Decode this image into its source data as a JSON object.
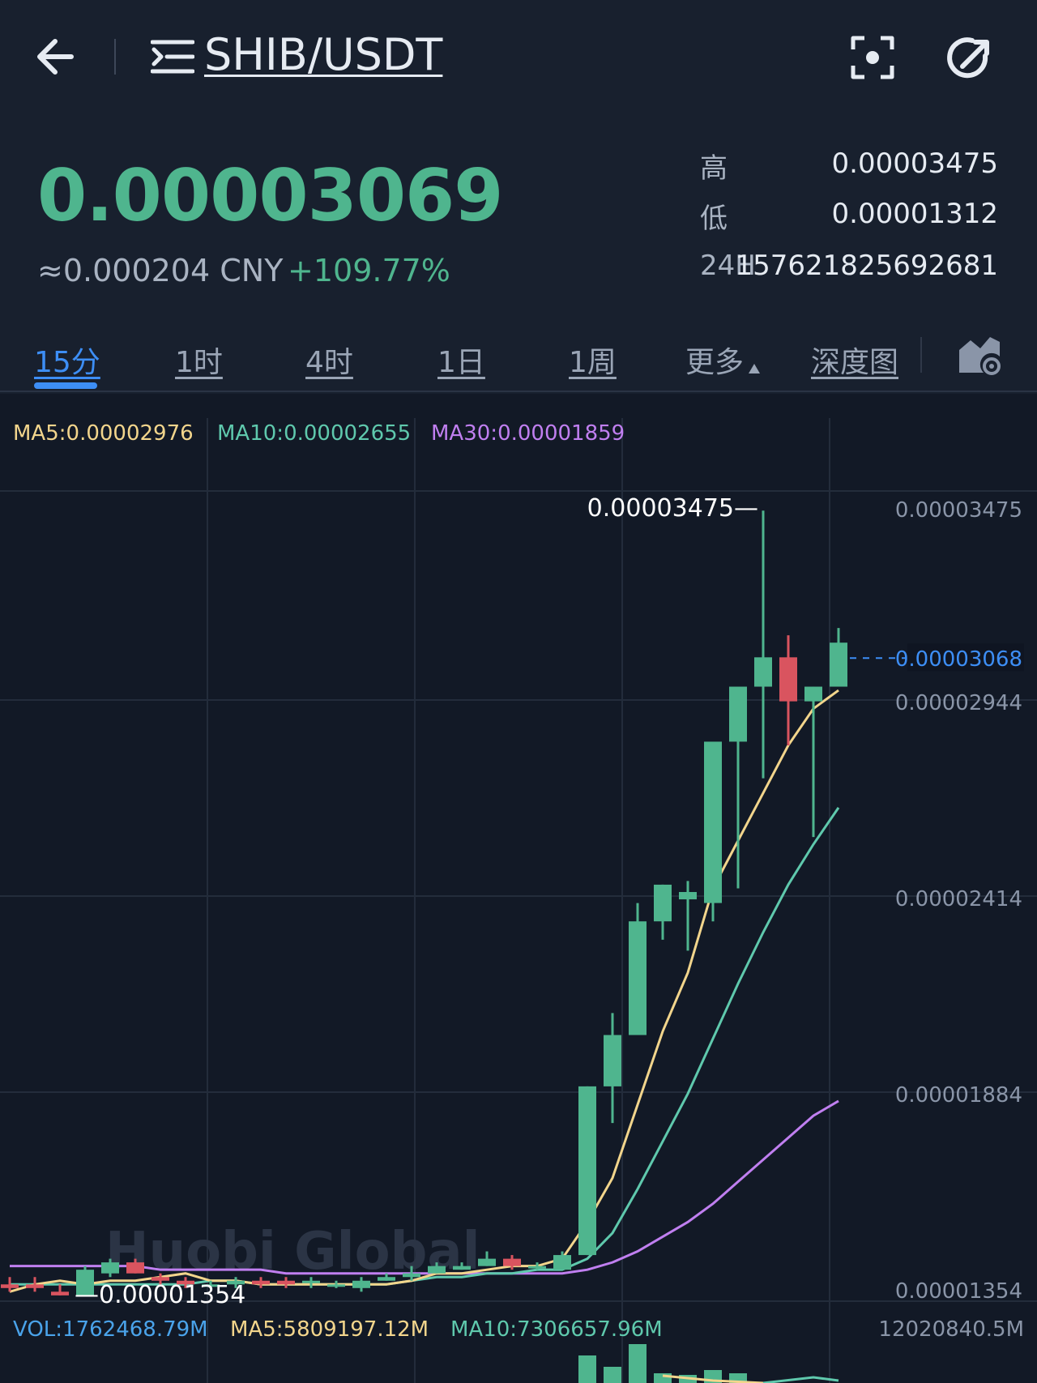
{
  "header": {
    "pair": "SHIB/USDT"
  },
  "ticker": {
    "last_price": "0.00003069",
    "cny_value": "≈0.000204 CNY",
    "change_pct": "+109.77%",
    "high_label": "高",
    "high_value": "0.00003475",
    "low_label": "低",
    "low_value": "0.00001312",
    "vol_label": "24H",
    "vol_value": "157621825692681"
  },
  "tabs": [
    {
      "label": "15分",
      "active": true
    },
    {
      "label": "1时"
    },
    {
      "label": "4时"
    },
    {
      "label": "1日"
    },
    {
      "label": "1周"
    },
    {
      "label": "更多"
    },
    {
      "label": "深度图"
    }
  ],
  "colors": {
    "up": "#4fb58e",
    "down": "#d9545f",
    "ma5": "#f2d58c",
    "ma10": "#5fc9ad",
    "ma30": "#c07ff0",
    "vol": "#4aa3ea",
    "accent": "#3d8ef5"
  },
  "chart_data": {
    "type": "candlestick",
    "indicators": {
      "ma5": "MA5:0.00002976",
      "ma10": "MA10:0.00002655",
      "ma30": "MA30:0.00001859"
    },
    "y_ticks": [
      "0.00003475",
      "0.00002944",
      "0.00002414",
      "0.00001884",
      "0.00001354"
    ],
    "ylim": [
      1.354e-05,
      3.475e-05
    ],
    "current_price_label": "0.00003068",
    "current_price": 3.068e-05,
    "max_marker": "0.00003475—",
    "min_marker": "—0.00001354",
    "candles": [
      {
        "o": 1.36e-05,
        "h": 1.38e-05,
        "l": 1.34e-05,
        "c": 1.35e-05
      },
      {
        "o": 1.36e-05,
        "h": 1.38e-05,
        "l": 1.34e-05,
        "c": 1.35e-05
      },
      {
        "o": 1.34e-05,
        "h": 1.36e-05,
        "l": 1.33e-05,
        "c": 1.33e-05
      },
      {
        "o": 1.33e-05,
        "h": 1.41e-05,
        "l": 1.33e-05,
        "c": 1.4e-05
      },
      {
        "o": 1.39e-05,
        "h": 1.43e-05,
        "l": 1.38e-05,
        "c": 1.42e-05
      },
      {
        "o": 1.42e-05,
        "h": 1.43e-05,
        "l": 1.39e-05,
        "c": 1.39e-05
      },
      {
        "o": 1.38e-05,
        "h": 1.39e-05,
        "l": 1.36e-05,
        "c": 1.37e-05
      },
      {
        "o": 1.37e-05,
        "h": 1.38e-05,
        "l": 1.35e-05,
        "c": 1.36e-05
      },
      {
        "o": 1.36e-05,
        "h": 1.37e-05,
        "l": 1.35e-05,
        "c": 1.36e-05
      },
      {
        "o": 1.36e-05,
        "h": 1.38e-05,
        "l": 1.35e-05,
        "c": 1.37e-05
      },
      {
        "o": 1.37e-05,
        "h": 1.38e-05,
        "l": 1.35e-05,
        "c": 1.36e-05
      },
      {
        "o": 1.37e-05,
        "h": 1.38e-05,
        "l": 1.35e-05,
        "c": 1.36e-05
      },
      {
        "o": 1.37e-05,
        "h": 1.38e-05,
        "l": 1.35e-05,
        "c": 1.37e-05
      },
      {
        "o": 1.36e-05,
        "h": 1.37e-05,
        "l": 1.35e-05,
        "c": 1.36e-05
      },
      {
        "o": 1.35e-05,
        "h": 1.38e-05,
        "l": 1.34e-05,
        "c": 1.37e-05
      },
      {
        "o": 1.37e-05,
        "h": 1.39e-05,
        "l": 1.37e-05,
        "c": 1.38e-05
      },
      {
        "o": 1.38e-05,
        "h": 1.41e-05,
        "l": 1.37e-05,
        "c": 1.39e-05
      },
      {
        "o": 1.39e-05,
        "h": 1.42e-05,
        "l": 1.39e-05,
        "c": 1.41e-05
      },
      {
        "o": 1.4e-05,
        "h": 1.42e-05,
        "l": 1.4e-05,
        "c": 1.41e-05
      },
      {
        "o": 1.41e-05,
        "h": 1.45e-05,
        "l": 1.41e-05,
        "c": 1.43e-05
      },
      {
        "o": 1.43e-05,
        "h": 1.44e-05,
        "l": 1.4e-05,
        "c": 1.41e-05
      },
      {
        "o": 1.41e-05,
        "h": 1.42e-05,
        "l": 1.4e-05,
        "c": 1.41e-05
      },
      {
        "o": 1.4e-05,
        "h": 1.45e-05,
        "l": 1.4e-05,
        "c": 1.44e-05
      },
      {
        "o": 1.44e-05,
        "h": 1.9e-05,
        "l": 1.44e-05,
        "c": 1.9e-05
      },
      {
        "o": 1.9e-05,
        "h": 2.1e-05,
        "l": 1.8e-05,
        "c": 2.04e-05
      },
      {
        "o": 2.04e-05,
        "h": 2.4e-05,
        "l": 2.04e-05,
        "c": 2.35e-05
      },
      {
        "o": 2.35e-05,
        "h": 2.45e-05,
        "l": 2.3e-05,
        "c": 2.45e-05
      },
      {
        "o": 2.41e-05,
        "h": 2.46e-05,
        "l": 2.27e-05,
        "c": 2.43e-05
      },
      {
        "o": 2.4e-05,
        "h": 2.79e-05,
        "l": 2.35e-05,
        "c": 2.84e-05
      },
      {
        "o": 2.84e-05,
        "h": 2.98e-05,
        "l": 2.44e-05,
        "c": 2.99e-05
      },
      {
        "o": 2.99e-05,
        "h": 3.47e-05,
        "l": 2.74e-05,
        "c": 3.07e-05
      },
      {
        "o": 3.07e-05,
        "h": 3.13e-05,
        "l": 2.83e-05,
        "c": 2.95e-05
      },
      {
        "o": 2.95e-05,
        "h": 2.99e-05,
        "l": 2.58e-05,
        "c": 2.99e-05
      },
      {
        "o": 2.99e-05,
        "h": 3.15e-05,
        "l": 2.99e-05,
        "c": 3.11e-05
      }
    ],
    "ma5_line": [
      1.34e-05,
      1.36e-05,
      1.37e-05,
      1.36e-05,
      1.37e-05,
      1.37e-05,
      1.38e-05,
      1.39e-05,
      1.37e-05,
      1.37e-05,
      1.36e-05,
      1.36e-05,
      1.36e-05,
      1.36e-05,
      1.36e-05,
      1.36e-05,
      1.37e-05,
      1.39e-05,
      1.39e-05,
      1.4e-05,
      1.41e-05,
      1.41e-05,
      1.43e-05,
      1.53e-05,
      1.65e-05,
      1.85e-05,
      2.05e-05,
      2.21e-05,
      2.44e-05,
      2.57e-05,
      2.7e-05,
      2.83e-05,
      2.93e-05,
      2.98e-05
    ],
    "ma10_line": [
      1.36e-05,
      1.36e-05,
      1.36e-05,
      1.36e-05,
      1.36e-05,
      1.36e-05,
      1.36e-05,
      1.36e-05,
      1.37e-05,
      1.37e-05,
      1.36e-05,
      1.36e-05,
      1.36e-05,
      1.36e-05,
      1.36e-05,
      1.36e-05,
      1.37e-05,
      1.38e-05,
      1.38e-05,
      1.39e-05,
      1.39e-05,
      1.4e-05,
      1.4e-05,
      1.43e-05,
      1.5e-05,
      1.62e-05,
      1.75e-05,
      1.88e-05,
      2.03e-05,
      2.18e-05,
      2.32e-05,
      2.45e-05,
      2.56e-05,
      2.66e-05
    ],
    "ma30_line": [
      1.41e-05,
      1.41e-05,
      1.41e-05,
      1.41e-05,
      1.41e-05,
      1.41e-05,
      1.4e-05,
      1.4e-05,
      1.4e-05,
      1.4e-05,
      1.4e-05,
      1.39e-05,
      1.39e-05,
      1.39e-05,
      1.39e-05,
      1.39e-05,
      1.39e-05,
      1.39e-05,
      1.39e-05,
      1.39e-05,
      1.39e-05,
      1.39e-05,
      1.39e-05,
      1.4e-05,
      1.42e-05,
      1.45e-05,
      1.49e-05,
      1.53e-05,
      1.58e-05,
      1.64e-05,
      1.7e-05,
      1.76e-05,
      1.82e-05,
      1.86e-05
    ],
    "volume": {
      "vol_label": "VOL:1762468.79M",
      "ma5_label": "MA5:5809197.12M",
      "ma10_label": "MA10:7306657.96M",
      "max_label": "12020840.5M"
    }
  }
}
